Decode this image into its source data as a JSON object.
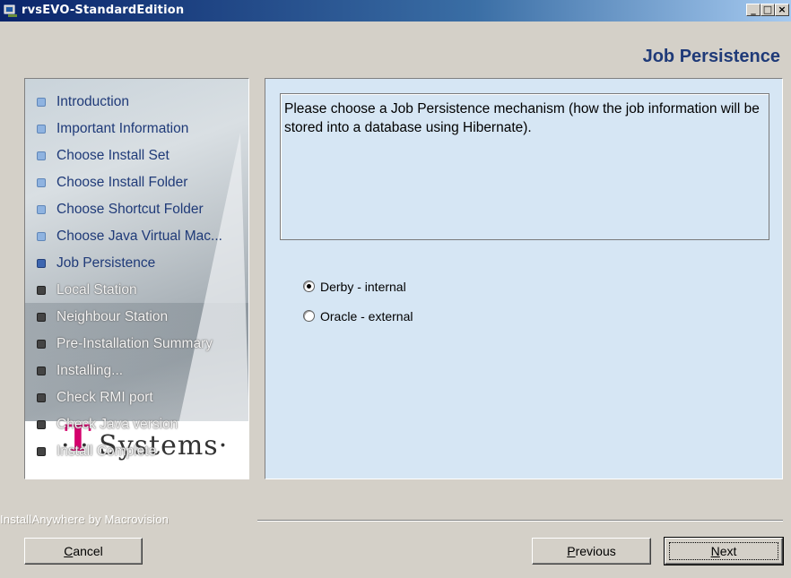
{
  "window": {
    "title": "rvsEVO-StandardEdition",
    "icon": "installer-app-icon",
    "controls": {
      "minimize": "_",
      "maximize": "□",
      "close": "×"
    }
  },
  "header": {
    "title": "Job Persistence"
  },
  "steps": [
    {
      "label": "Introduction",
      "state": "done"
    },
    {
      "label": "Important Information",
      "state": "done"
    },
    {
      "label": "Choose Install Set",
      "state": "done"
    },
    {
      "label": "Choose Install Folder",
      "state": "done"
    },
    {
      "label": "Choose Shortcut Folder",
      "state": "done"
    },
    {
      "label": "Choose Java Virtual Mac...",
      "state": "done"
    },
    {
      "label": "Job Persistence",
      "state": "current"
    },
    {
      "label": "Local Station",
      "state": "todo"
    },
    {
      "label": "Neighbour Station",
      "state": "todo"
    },
    {
      "label": "Pre-Installation Summary",
      "state": "todo"
    },
    {
      "label": "Installing...",
      "state": "todo"
    },
    {
      "label": "Check RMI port",
      "state": "todo"
    },
    {
      "label": "Check Java version",
      "state": "todo"
    },
    {
      "label": "Install Complete",
      "state": "todo"
    }
  ],
  "logo": {
    "brand_t": "T",
    "brand_text": "· · Systems·"
  },
  "content": {
    "description": "Please choose a Job Persistence mechanism (how the job information will be stored into a database using Hibernate).",
    "options": [
      {
        "label": "Derby - internal",
        "selected": true
      },
      {
        "label": "Oracle - external",
        "selected": false
      }
    ]
  },
  "footer": {
    "vendor": "InstallAnywhere by Macrovision",
    "cancel": {
      "pre": "",
      "mnemonic": "C",
      "post": "ancel"
    },
    "previous": {
      "pre": "",
      "mnemonic": "P",
      "post": "revious"
    },
    "next": {
      "pre": "",
      "mnemonic": "N",
      "post": "ext"
    }
  },
  "colors": {
    "titlebar_start": "#0a246a",
    "titlebar_end": "#a6caf0",
    "accent_text": "#1f3a78",
    "content_bg": "#d6e6f4",
    "brand_magenta": "#d4006c"
  }
}
